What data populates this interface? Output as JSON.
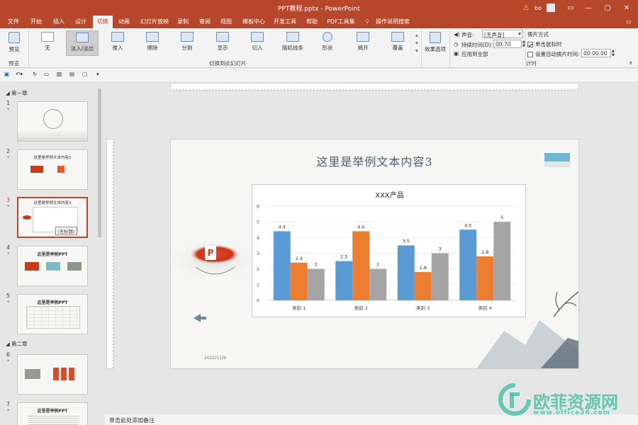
{
  "window": {
    "title": "PPT教程.pptx  -  PowerPoint",
    "user": "bo"
  },
  "menu_tabs": [
    "文件",
    "开始",
    "插入",
    "设计",
    "切换",
    "动画",
    "幻灯片放映",
    "录制",
    "审阅",
    "视图",
    "模板中心",
    "开发工具",
    "帮助",
    "PDF工具集",
    "操作说明搜索"
  ],
  "ribbon": {
    "preview": {
      "label": "预览",
      "group": "预览"
    },
    "transitions": [
      {
        "label": "无"
      },
      {
        "label": "淡入/淡出"
      },
      {
        "label": "推入"
      },
      {
        "label": "擦除"
      },
      {
        "label": "分割"
      },
      {
        "label": "显示"
      },
      {
        "label": "切入"
      },
      {
        "label": "随机线条"
      },
      {
        "label": "形状"
      },
      {
        "label": "揭开"
      },
      {
        "label": "覆盖"
      }
    ],
    "transitions_group": "切换到此幻灯片",
    "effect_options": "效果选项",
    "timing": {
      "sound_label": "声音:",
      "sound_value": "[无声音]",
      "duration_label": "持续时间(D):",
      "duration_value": "00.70",
      "apply_all": "应用到全部",
      "advance_title": "换片方式",
      "on_click": "单击鼠标时",
      "after_label": "设置自动换片时间:",
      "after_value": "00:00.00",
      "group": "计时"
    }
  },
  "slides_pane": {
    "sections": [
      {
        "name": "第一章"
      },
      {
        "name": "第二章"
      }
    ],
    "slides": [
      {
        "num": "1",
        "star": "*",
        "title": ""
      },
      {
        "num": "2",
        "star": "*",
        "title": "这里是举例文本内容2"
      },
      {
        "num": "3",
        "star": "*",
        "title": "这里是举例文本内容3",
        "tooltip": "(无标题)"
      },
      {
        "num": "4",
        "star": "*",
        "title": "这里是举例PPT"
      },
      {
        "num": "5",
        "star": "*",
        "title": "这里是举例PPT"
      },
      {
        "num": "6",
        "star": "*",
        "title": ""
      },
      {
        "num": "7",
        "star": "*",
        "title": "这里是举例PPT"
      }
    ]
  },
  "slide": {
    "title": "这里是举例文本内容3",
    "date": "2022/11/9"
  },
  "chart_data": {
    "type": "bar",
    "title": "XXX产品",
    "categories": [
      "类别 1",
      "类别 2",
      "类别 3",
      "类别 4"
    ],
    "series": [
      {
        "values": [
          4.4,
          2.5,
          3.5,
          4.5
        ],
        "color": "#5b9bd5"
      },
      {
        "values": [
          2.4,
          4.4,
          1.8,
          2.8
        ],
        "color": "#ed7d31"
      },
      {
        "values": [
          2,
          2,
          3,
          5
        ],
        "color": "#a5a5a5"
      }
    ],
    "ylim": [
      0,
      6
    ],
    "yticks": [
      "0",
      "1",
      "2",
      "3",
      "4",
      "5",
      "6"
    ],
    "grid": true
  },
  "status": {
    "notes": "单击此处添加备注"
  },
  "watermark": {
    "text": "欧菲资源网",
    "url": "www.office26.com"
  },
  "colors": {
    "accent": "#b7472a"
  }
}
